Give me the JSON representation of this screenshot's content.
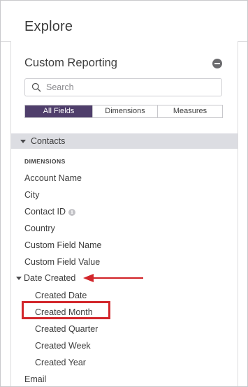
{
  "header": {
    "title": "Explore"
  },
  "panel": {
    "title": "Custom Reporting",
    "search": {
      "placeholder": "Search",
      "value": ""
    },
    "tabs": [
      {
        "label": "All Fields",
        "active": true
      },
      {
        "label": "Dimensions",
        "active": false
      },
      {
        "label": "Measures",
        "active": false
      }
    ],
    "section": {
      "label": "Contacts",
      "expanded": true
    },
    "group_label": "DIMENSIONS",
    "fields": [
      "Account Name",
      "City",
      "Contact ID",
      "Country",
      "Custom Field Name",
      "Custom Field Value"
    ],
    "date_group": {
      "label": "Date Created",
      "expanded": true,
      "children": [
        "Created Date",
        "Created Month",
        "Created Quarter",
        "Created Week",
        "Created Year"
      ]
    },
    "trailing_field": "Email"
  },
  "colors": {
    "active_tab": "#4f3e6b",
    "annotation": "#d2262b",
    "section_bg": "#dcdde2"
  }
}
